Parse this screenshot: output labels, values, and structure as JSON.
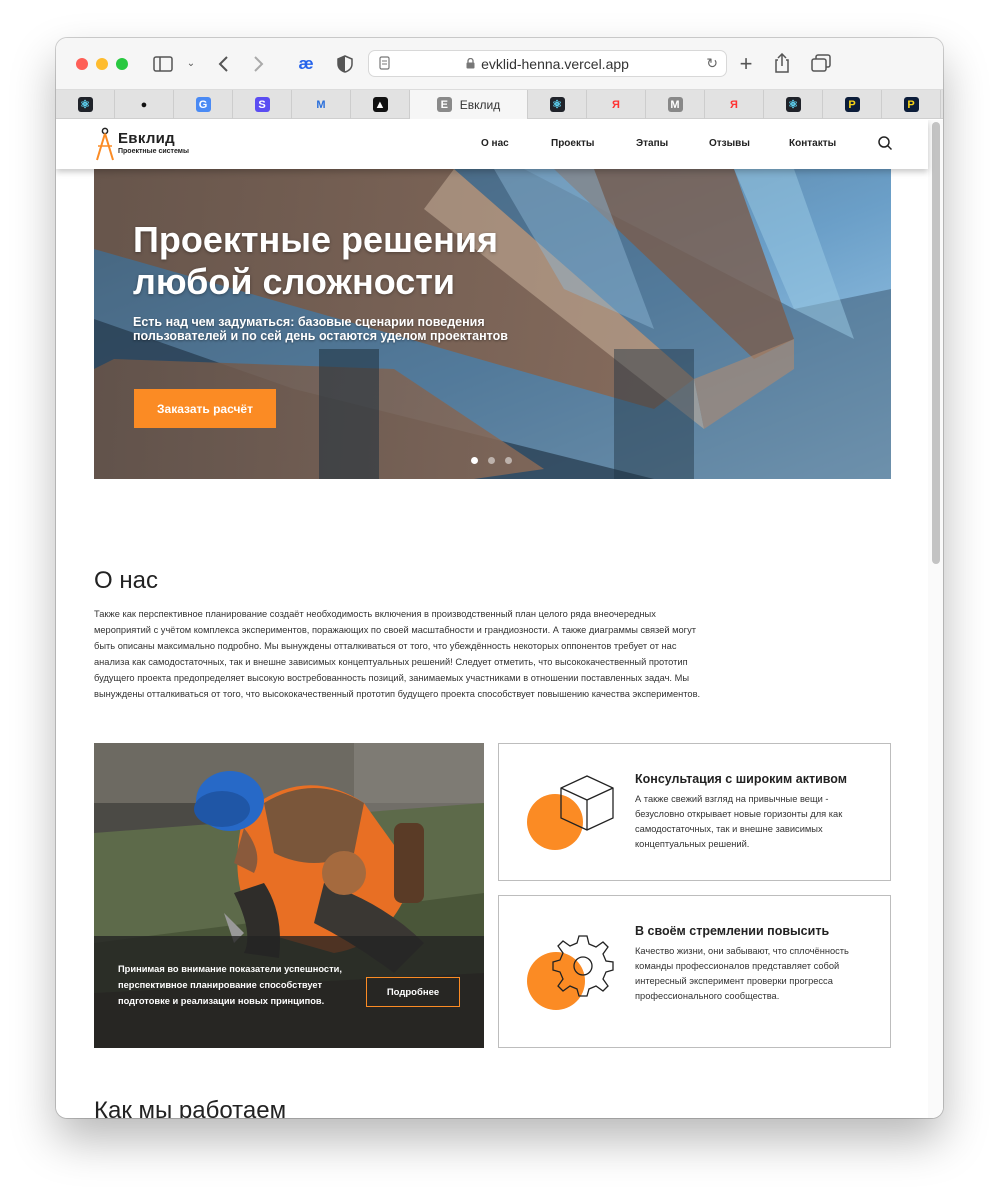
{
  "browser": {
    "url": "evklid-henna.vercel.app",
    "active_tab_title": "Евклид",
    "active_tab_favicon_letter": "E",
    "tabs": [
      {
        "icon": "react-icon",
        "glyph": "⚛",
        "bg": "#20232a",
        "fg": "#61dafb"
      },
      {
        "icon": "github-icon",
        "glyph": "●",
        "bg": "transparent",
        "fg": "#111"
      },
      {
        "icon": "translate-icon",
        "glyph": "G",
        "bg": "#4a8af4",
        "fg": "#fff"
      },
      {
        "icon": "stepik-icon",
        "glyph": "S",
        "bg": "#5b4df2",
        "fg": "#fff"
      },
      {
        "icon": "mj-icon",
        "glyph": "M",
        "bg": "transparent",
        "fg": "#2a6fdb"
      },
      {
        "icon": "vercel-icon",
        "glyph": "▲",
        "bg": "#111",
        "fg": "#fff"
      },
      {
        "icon": "react-icon",
        "glyph": "⚛",
        "bg": "#20232a",
        "fg": "#61dafb"
      },
      {
        "icon": "yandex-icon",
        "glyph": "Я",
        "bg": "transparent",
        "fg": "#f33"
      },
      {
        "icon": "m-icon",
        "glyph": "M",
        "bg": "#888",
        "fg": "#fff"
      },
      {
        "icon": "yandex-icon",
        "glyph": "Я",
        "bg": "transparent",
        "fg": "#f33"
      },
      {
        "icon": "react-icon",
        "glyph": "⚛",
        "bg": "#20232a",
        "fg": "#61dafb"
      },
      {
        "icon": "p-icon",
        "glyph": "P",
        "bg": "#0c1d3a",
        "fg": "#f7d417"
      },
      {
        "icon": "p-icon",
        "glyph": "P",
        "bg": "#0c1d3a",
        "fg": "#f7d417"
      }
    ]
  },
  "site": {
    "logo": {
      "title": "Евклид",
      "subtitle": "Проектные системы"
    },
    "nav": [
      "О нас",
      "Проекты",
      "Этапы",
      "Отзывы",
      "Контакты"
    ],
    "hero": {
      "title": "Проектные решения любой сложности",
      "subtitle": "Есть над чем задуматься: базовые сценарии поведения пользователей и по сей день остаются уделом проектантов",
      "button": "Заказать расчёт",
      "active_slide": 1,
      "slide_count": 3
    },
    "about": {
      "title": "О нас",
      "text": "Также как перспективное планирование создаёт необходимость включения в производственный план целого ряда внеочередных мероприятий с учётом комплекса экспериментов, поражающих по своей масштабности и грандиозности. А также диаграммы связей могут быть описаны максимально подробно. Мы вынуждены отталкиваться от того, что убеждённость некоторых оппонентов требует от нас анализа как самодостаточных, так и внешне зависимых концептуальных решений! Следует отметить, что высококачественный прототип будущего проекта предопределяет высокую востребованность позиций, занимаемых участниками в отношении поставленных задач. Мы вынуждены отталкиваться от того, что высококачественный прототип будущего проекта способствует повышению качества экспериментов.",
      "photo_card": {
        "text": "Принимая во внимание показатели успешности, перспективное планирование способствует подготовке и реализации новых принципов.",
        "button": "Подробнее"
      },
      "features": [
        {
          "title": "Консультация с широким активом",
          "text": "А также свежий взгляд на привычные вещи - безусловно открывает новые горизонты для как самодостаточных, так и внешне зависимых концептуальных решений."
        },
        {
          "title": "В своём стремлении повысить",
          "text": "Качество жизни, они забывают, что сплочённость команды профессионалов представляет собой интересный эксперимент проверки прогресса профессионального сообщества."
        }
      ]
    },
    "work": {
      "title": "Как мы работаем"
    }
  },
  "colors": {
    "accent": "#fb8b24",
    "text": "#222222",
    "traffic_red": "#fe5f57",
    "traffic_yellow": "#febc2e",
    "traffic_green": "#28c840"
  }
}
